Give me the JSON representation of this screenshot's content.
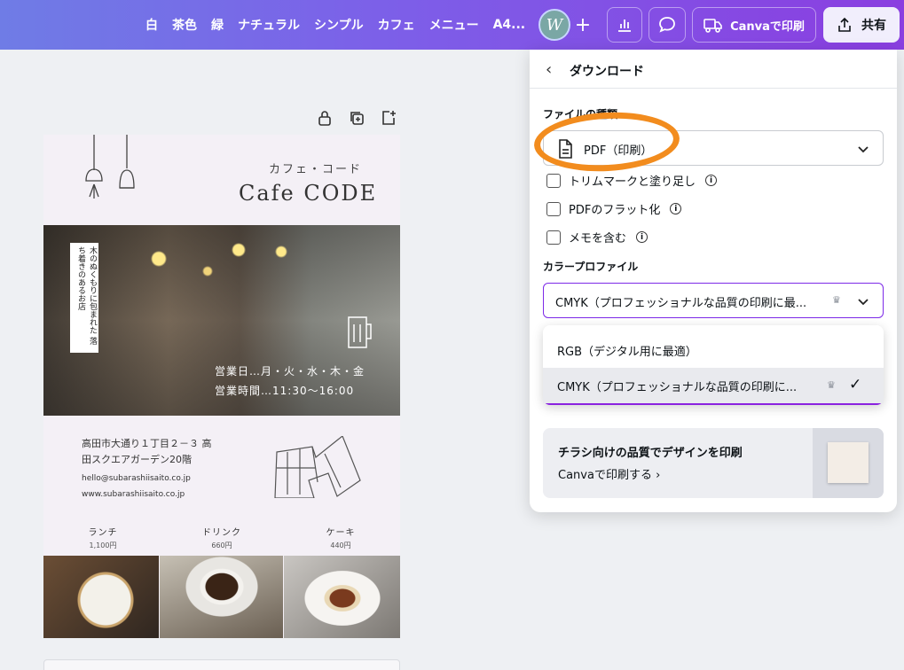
{
  "topbar": {
    "tags": [
      "白",
      "茶色",
      "緑",
      "ナチュラル",
      "シンプル",
      "カフェ",
      "メニュー",
      "A4..."
    ],
    "avatar_letter": "W",
    "print_label": "Canvaで印刷",
    "share_label": "共有"
  },
  "design": {
    "subtitle": "カフェ・コード",
    "title": "Cafe CODE",
    "vertical_text": "木のぬくもりに包まれた 落ち着きのあるお店",
    "hours_days": "営業日…月・火・水・木・金",
    "hours_time": "営業時間…11:30〜16:00",
    "address_line1": "高田市大通り１丁目２－３ 高",
    "address_line2": "田スクエアガーデン20階",
    "email": "hello@subarashiisaito.co.jp",
    "website": "www.subarashiisaito.co.jp",
    "menu": [
      {
        "name": "ランチ",
        "price": "1,100円"
      },
      {
        "name": "ドリンク",
        "price": "660円"
      },
      {
        "name": "ケーキ",
        "price": "440円"
      }
    ]
  },
  "panel": {
    "title": "ダウンロード",
    "file_type_label": "ファイルの種類",
    "file_type_value": "PDF（印刷）",
    "options": [
      {
        "label": "トリムマークと塗り足し",
        "checked": false
      },
      {
        "label": "PDFのフラット化",
        "checked": false
      },
      {
        "label": "メモを含む",
        "checked": false
      }
    ],
    "color_profile_label": "カラープロファイル",
    "color_profile_value": "CMYK（プロフェッショナルな品質の印刷に最...",
    "dropdown_options": [
      {
        "label": "RGB（デジタル用に最適）",
        "selected": false
      },
      {
        "label": "CMYK（プロフェッショナルな品質の印刷に...",
        "selected": true
      }
    ],
    "promo_title": "チラシ向けの品質でデザインを印刷",
    "promo_link": "Canvaで印刷する"
  },
  "colors": {
    "accent": "#7d2ae8",
    "highlight": "#f28c1e"
  }
}
